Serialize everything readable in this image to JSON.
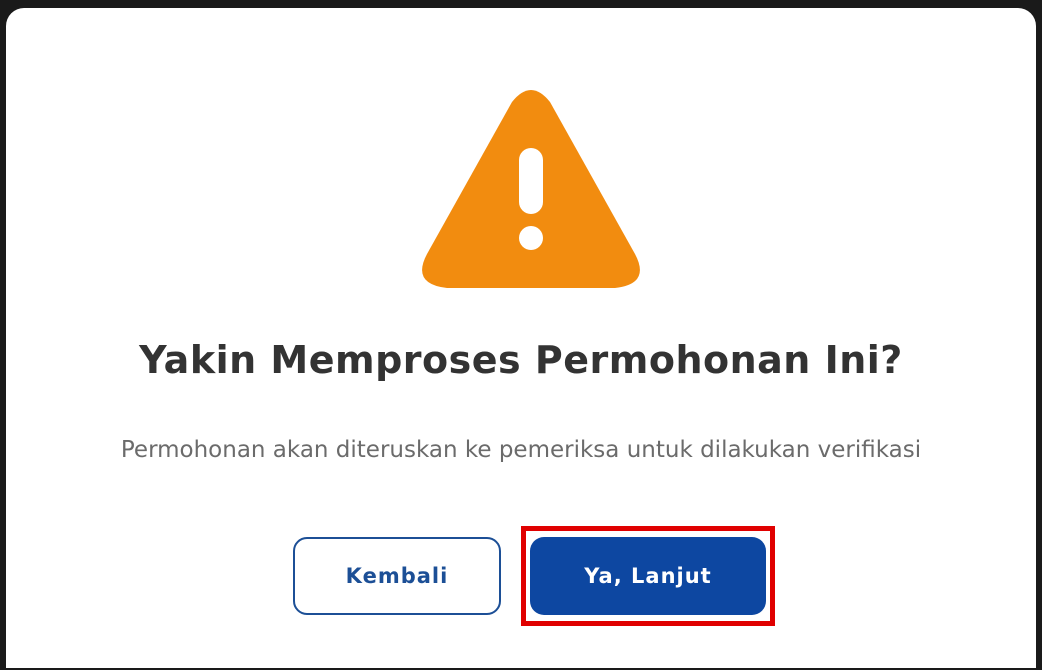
{
  "dialog": {
    "icon": "warning-triangle-icon",
    "icon_color": "#F28C0F",
    "title": "Yakin Memproses Permohonan Ini?",
    "message": "Permohonan akan diteruskan ke pemeriksa untuk dilakukan verifikasi",
    "buttons": {
      "back_label": "Kembali",
      "continue_label": "Ya, Lanjut"
    },
    "colors": {
      "primary": "#0D47A1",
      "outline": "#1C4F96",
      "title": "#333333",
      "message": "#6B6B6B",
      "highlight": "#E00000"
    }
  }
}
